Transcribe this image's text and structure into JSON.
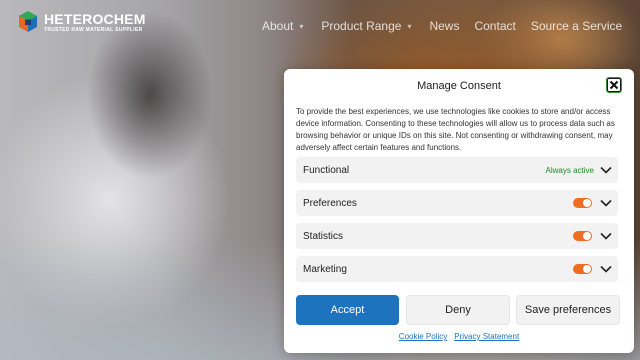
{
  "brand": {
    "name": "HETEROCHEM",
    "tagline": "TRUSTED RAW MATERIAL SUPPLIER",
    "logo_colors": [
      "#2fa84f",
      "#e8672a",
      "#1d6fb8",
      "#1a3a6b"
    ]
  },
  "nav": {
    "items": [
      {
        "label": "About",
        "has_dropdown": true
      },
      {
        "label": "Product Range",
        "has_dropdown": true
      },
      {
        "label": "News",
        "has_dropdown": false
      },
      {
        "label": "Contact",
        "has_dropdown": false
      },
      {
        "label": "Source a Service",
        "has_dropdown": false
      }
    ]
  },
  "consent": {
    "title": "Manage Consent",
    "description": "To provide the best experiences, we use technologies like cookies to store and/or access device information. Consenting to these technologies will allow us to process data such as browsing behavior or unique IDs on this site. Not consenting or withdrawing consent, may adversely affect certain features and functions.",
    "categories": [
      {
        "label": "Functional",
        "status": "Always active",
        "toggle": null
      },
      {
        "label": "Preferences",
        "status": null,
        "toggle": "on"
      },
      {
        "label": "Statistics",
        "status": null,
        "toggle": "on"
      },
      {
        "label": "Marketing",
        "status": null,
        "toggle": "on"
      }
    ],
    "buttons": {
      "accept": "Accept",
      "deny": "Deny",
      "save": "Save preferences"
    },
    "links": {
      "cookie_policy": "Cookie Policy",
      "privacy_statement": "Privacy Statement"
    },
    "colors": {
      "accent": "#1e73be",
      "toggle_on": "#f06b24",
      "always_active": "#1e8c2c"
    }
  }
}
